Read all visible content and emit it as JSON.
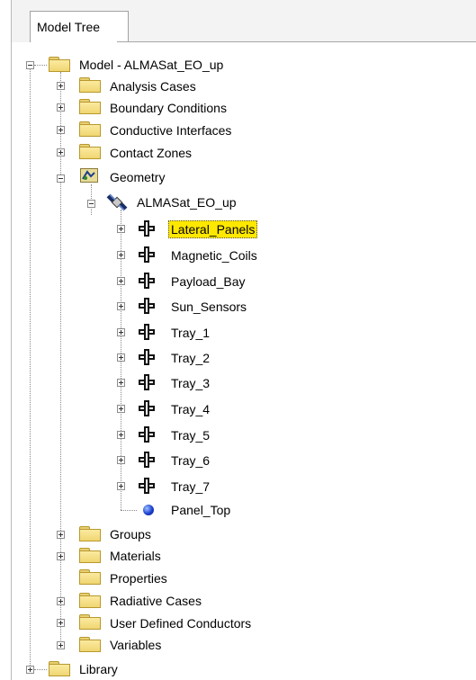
{
  "tabs": {
    "model_tree": "Model Tree"
  },
  "tree": {
    "root": "Model - ALMASat_EO_up",
    "folders_top": [
      "Analysis Cases",
      "Boundary Conditions",
      "Conductive Interfaces",
      "Contact Zones"
    ],
    "geometry": "Geometry",
    "assembly": "ALMASat_EO_up",
    "parts": [
      "Lateral_Panels",
      "Magnetic_Coils",
      "Payload_Bay",
      "Sun_Sensors",
      "Tray_1",
      "Tray_2",
      "Tray_3",
      "Tray_4",
      "Tray_5",
      "Tray_6",
      "Tray_7"
    ],
    "panel_top": "Panel_Top",
    "folders_bottom": [
      "Groups",
      "Materials",
      "Properties",
      "Radiative Cases",
      "User Defined Conductors",
      "Variables"
    ],
    "library": "Library",
    "selected_item": "Lateral_Panels"
  },
  "icons": {
    "folder": "folder-icon",
    "part": "part-cross-icon",
    "geometry": "geometry-icon",
    "assembly": "satellite-assembly-icon",
    "sphere": "sphere-icon"
  },
  "colors": {
    "selection": "#ffe800",
    "folder": "#f0d672"
  }
}
